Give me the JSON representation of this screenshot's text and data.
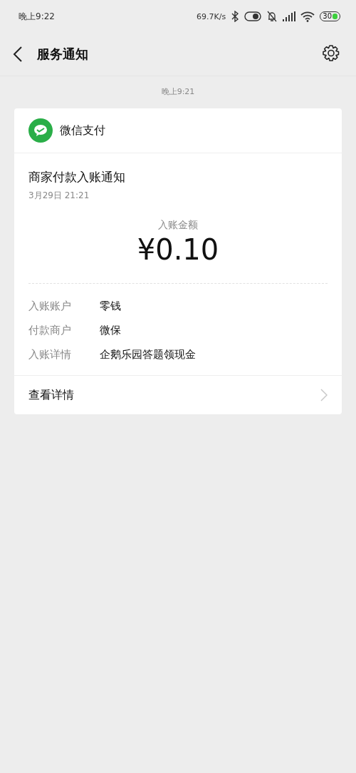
{
  "status_bar": {
    "time": "晚上9:22",
    "net_speed": "69.7K/s",
    "battery": "30"
  },
  "nav": {
    "title": "服务通知"
  },
  "timestamp": "晚上9:21",
  "card": {
    "source": "微信支付",
    "title": "商家付款入账通知",
    "date": "3月29日  21:21",
    "amount_label": "入账金额",
    "amount": "¥0.10",
    "details": [
      {
        "label": "入账账户",
        "value": "零钱"
      },
      {
        "label": "付款商户",
        "value": "微保"
      },
      {
        "label": "入账详情",
        "value": "企鹅乐园答题领现金"
      }
    ],
    "link": "查看详情"
  }
}
